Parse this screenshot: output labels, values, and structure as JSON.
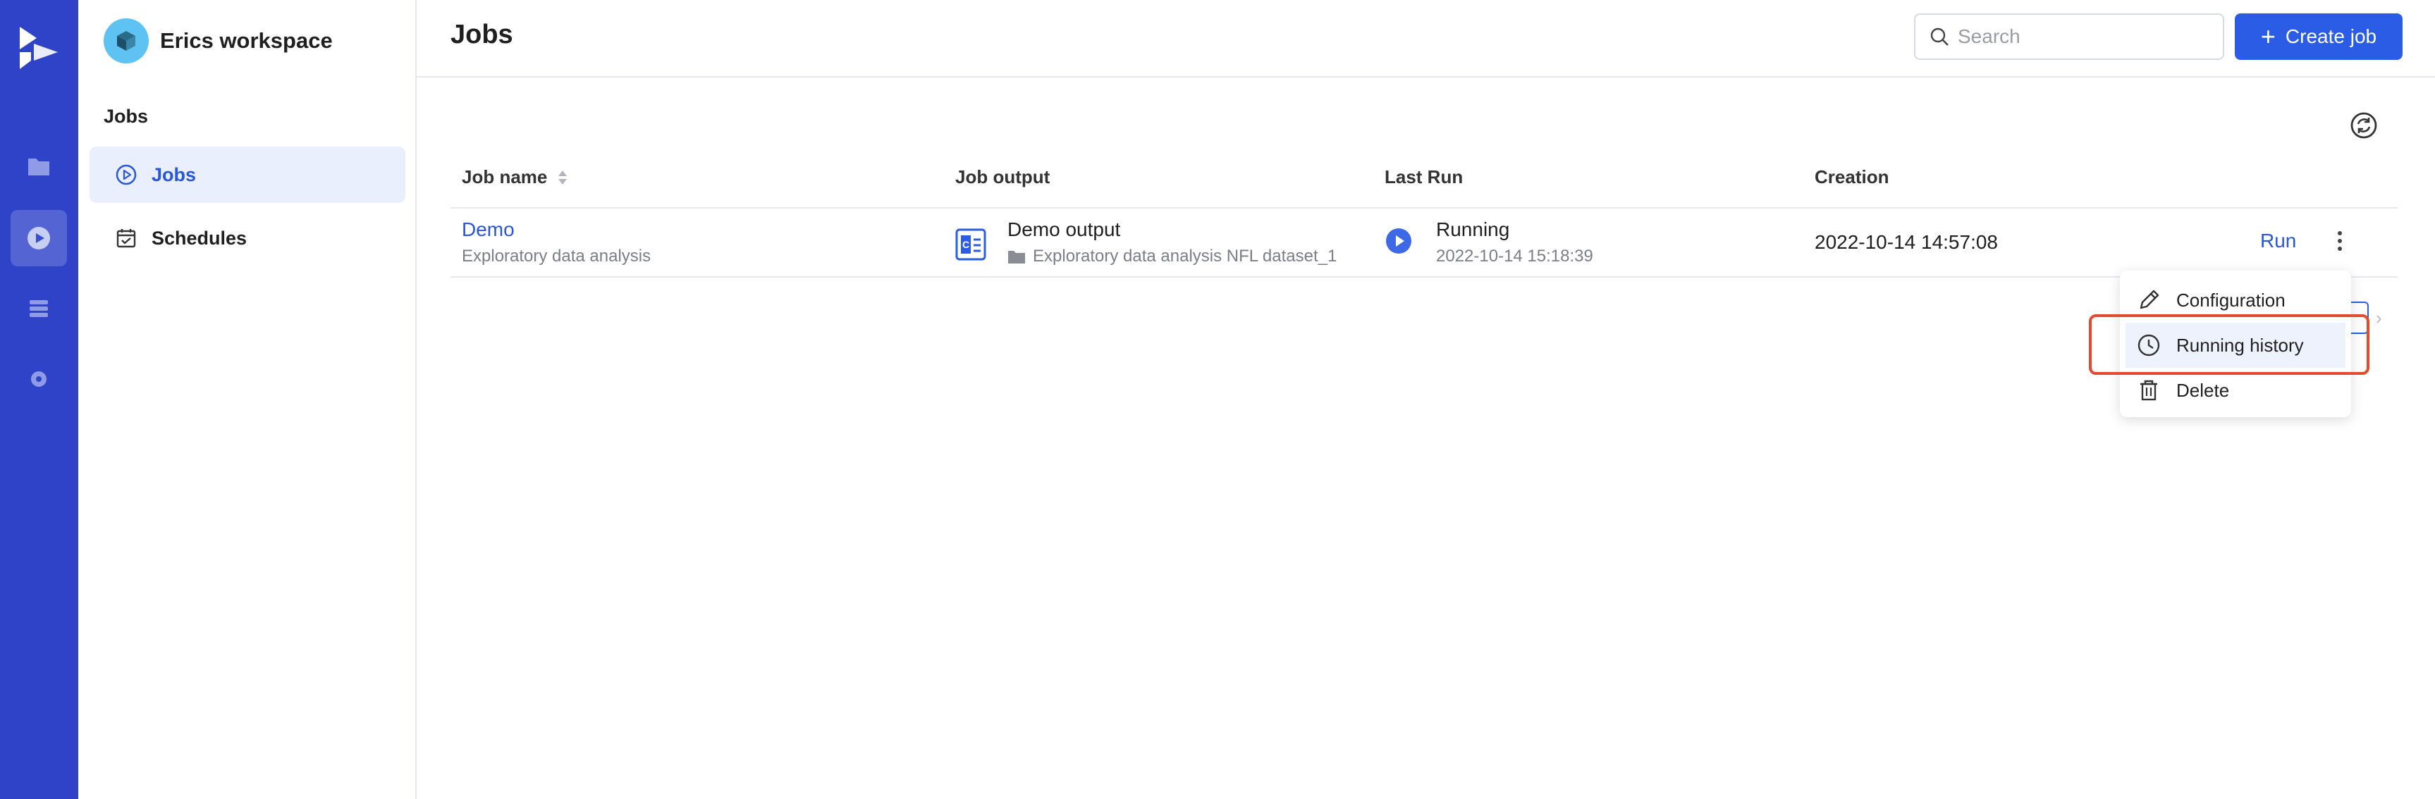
{
  "workspace": {
    "name": "Erics workspace"
  },
  "sidebar": {
    "section": "Jobs",
    "items": [
      {
        "label": "Jobs",
        "icon": "play-circle-icon",
        "active": true
      },
      {
        "label": "Schedules",
        "icon": "calendar-check-icon",
        "active": false
      }
    ]
  },
  "header": {
    "title": "Jobs",
    "search_placeholder": "Search",
    "create_label": "Create job"
  },
  "table": {
    "columns": [
      "Job name",
      "Job output",
      "Last Run",
      "Creation"
    ],
    "rows": [
      {
        "job_name": "Demo",
        "job_desc": "Exploratory data analysis",
        "output_name": "Demo output",
        "output_path": "Exploratory data analysis NFL dataset_1",
        "last_run_status": "Running",
        "last_run_time": "2022-10-14 15:18:39",
        "creation": "2022-10-14 14:57:08",
        "action": "Run"
      }
    ]
  },
  "menu": {
    "items": [
      {
        "label": "Configuration",
        "icon": "pencil-icon"
      },
      {
        "label": "Running history",
        "icon": "clock-icon",
        "highlighted": true
      },
      {
        "label": "Delete",
        "icon": "trash-icon"
      }
    ]
  },
  "colors": {
    "rail": "#2f43c9",
    "accent": "#2b5ce6",
    "highlight": "#e24b2f"
  }
}
